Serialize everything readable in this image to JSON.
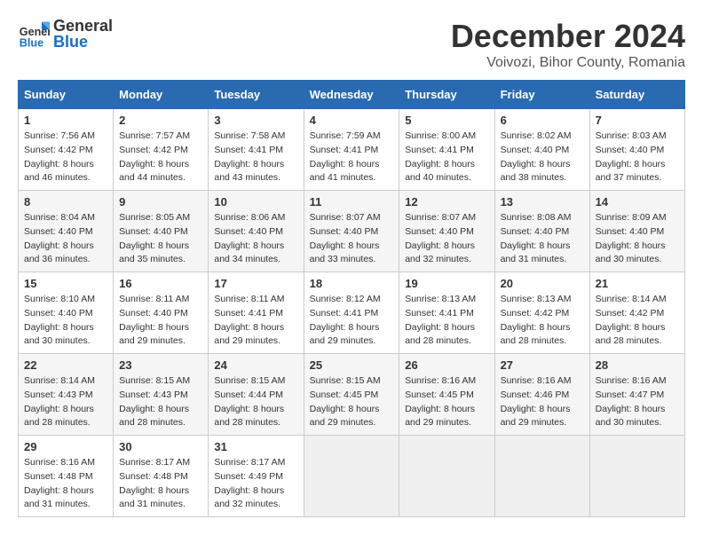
{
  "logo": {
    "general": "General",
    "blue": "Blue"
  },
  "title": "December 2024",
  "location": "Voivozi, Bihor County, Romania",
  "headers": [
    "Sunday",
    "Monday",
    "Tuesday",
    "Wednesday",
    "Thursday",
    "Friday",
    "Saturday"
  ],
  "weeks": [
    [
      {
        "day": "1",
        "sunrise": "7:56 AM",
        "sunset": "4:42 PM",
        "daylight": "8 hours and 46 minutes."
      },
      {
        "day": "2",
        "sunrise": "7:57 AM",
        "sunset": "4:42 PM",
        "daylight": "8 hours and 44 minutes."
      },
      {
        "day": "3",
        "sunrise": "7:58 AM",
        "sunset": "4:41 PM",
        "daylight": "8 hours and 43 minutes."
      },
      {
        "day": "4",
        "sunrise": "7:59 AM",
        "sunset": "4:41 PM",
        "daylight": "8 hours and 41 minutes."
      },
      {
        "day": "5",
        "sunrise": "8:00 AM",
        "sunset": "4:41 PM",
        "daylight": "8 hours and 40 minutes."
      },
      {
        "day": "6",
        "sunrise": "8:02 AM",
        "sunset": "4:40 PM",
        "daylight": "8 hours and 38 minutes."
      },
      {
        "day": "7",
        "sunrise": "8:03 AM",
        "sunset": "4:40 PM",
        "daylight": "8 hours and 37 minutes."
      }
    ],
    [
      {
        "day": "8",
        "sunrise": "8:04 AM",
        "sunset": "4:40 PM",
        "daylight": "8 hours and 36 minutes."
      },
      {
        "day": "9",
        "sunrise": "8:05 AM",
        "sunset": "4:40 PM",
        "daylight": "8 hours and 35 minutes."
      },
      {
        "day": "10",
        "sunrise": "8:06 AM",
        "sunset": "4:40 PM",
        "daylight": "8 hours and 34 minutes."
      },
      {
        "day": "11",
        "sunrise": "8:07 AM",
        "sunset": "4:40 PM",
        "daylight": "8 hours and 33 minutes."
      },
      {
        "day": "12",
        "sunrise": "8:07 AM",
        "sunset": "4:40 PM",
        "daylight": "8 hours and 32 minutes."
      },
      {
        "day": "13",
        "sunrise": "8:08 AM",
        "sunset": "4:40 PM",
        "daylight": "8 hours and 31 minutes."
      },
      {
        "day": "14",
        "sunrise": "8:09 AM",
        "sunset": "4:40 PM",
        "daylight": "8 hours and 30 minutes."
      }
    ],
    [
      {
        "day": "15",
        "sunrise": "8:10 AM",
        "sunset": "4:40 PM",
        "daylight": "8 hours and 30 minutes."
      },
      {
        "day": "16",
        "sunrise": "8:11 AM",
        "sunset": "4:40 PM",
        "daylight": "8 hours and 29 minutes."
      },
      {
        "day": "17",
        "sunrise": "8:11 AM",
        "sunset": "4:41 PM",
        "daylight": "8 hours and 29 minutes."
      },
      {
        "day": "18",
        "sunrise": "8:12 AM",
        "sunset": "4:41 PM",
        "daylight": "8 hours and 29 minutes."
      },
      {
        "day": "19",
        "sunrise": "8:13 AM",
        "sunset": "4:41 PM",
        "daylight": "8 hours and 28 minutes."
      },
      {
        "day": "20",
        "sunrise": "8:13 AM",
        "sunset": "4:42 PM",
        "daylight": "8 hours and 28 minutes."
      },
      {
        "day": "21",
        "sunrise": "8:14 AM",
        "sunset": "4:42 PM",
        "daylight": "8 hours and 28 minutes."
      }
    ],
    [
      {
        "day": "22",
        "sunrise": "8:14 AM",
        "sunset": "4:43 PM",
        "daylight": "8 hours and 28 minutes."
      },
      {
        "day": "23",
        "sunrise": "8:15 AM",
        "sunset": "4:43 PM",
        "daylight": "8 hours and 28 minutes."
      },
      {
        "day": "24",
        "sunrise": "8:15 AM",
        "sunset": "4:44 PM",
        "daylight": "8 hours and 28 minutes."
      },
      {
        "day": "25",
        "sunrise": "8:15 AM",
        "sunset": "4:45 PM",
        "daylight": "8 hours and 29 minutes."
      },
      {
        "day": "26",
        "sunrise": "8:16 AM",
        "sunset": "4:45 PM",
        "daylight": "8 hours and 29 minutes."
      },
      {
        "day": "27",
        "sunrise": "8:16 AM",
        "sunset": "4:46 PM",
        "daylight": "8 hours and 29 minutes."
      },
      {
        "day": "28",
        "sunrise": "8:16 AM",
        "sunset": "4:47 PM",
        "daylight": "8 hours and 30 minutes."
      }
    ],
    [
      {
        "day": "29",
        "sunrise": "8:16 AM",
        "sunset": "4:48 PM",
        "daylight": "8 hours and 31 minutes."
      },
      {
        "day": "30",
        "sunrise": "8:17 AM",
        "sunset": "4:48 PM",
        "daylight": "8 hours and 31 minutes."
      },
      {
        "day": "31",
        "sunrise": "8:17 AM",
        "sunset": "4:49 PM",
        "daylight": "8 hours and 32 minutes."
      },
      null,
      null,
      null,
      null
    ]
  ]
}
